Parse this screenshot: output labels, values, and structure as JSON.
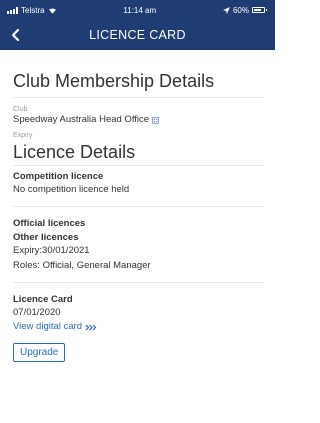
{
  "status_bar": {
    "carrier": "Telstra",
    "time": "11:14 am",
    "battery": "60%"
  },
  "navbar": {
    "title": "LICENCE CARD"
  },
  "club_section": {
    "title": "Club Membership Details",
    "club_label": "Club",
    "club_value": "Speedway Australia Head Office",
    "expiry_label": "Expiry"
  },
  "licence_section": {
    "title": "Licence Details",
    "competition_heading": "Competition licence",
    "competition_text": "No competition licence held",
    "official_heading": "Official licences",
    "other_heading": "Other licences",
    "expiry_text": "Expiry:30/01/2021",
    "roles_text": "Roles: Official, General Manager"
  },
  "licence_card": {
    "heading": "Licence Card",
    "date": "07/01/2020",
    "view_link": "View digital card"
  },
  "upgrade_button": "Upgrade",
  "colors": {
    "header": "#1f3d73",
    "link": "#2a6ebb"
  },
  "icons": [
    "signal-icon",
    "wifi-icon",
    "location-arrow-icon",
    "battery-icon",
    "back-chevron-icon",
    "building-icon",
    "double-chevron-right-icon"
  ]
}
